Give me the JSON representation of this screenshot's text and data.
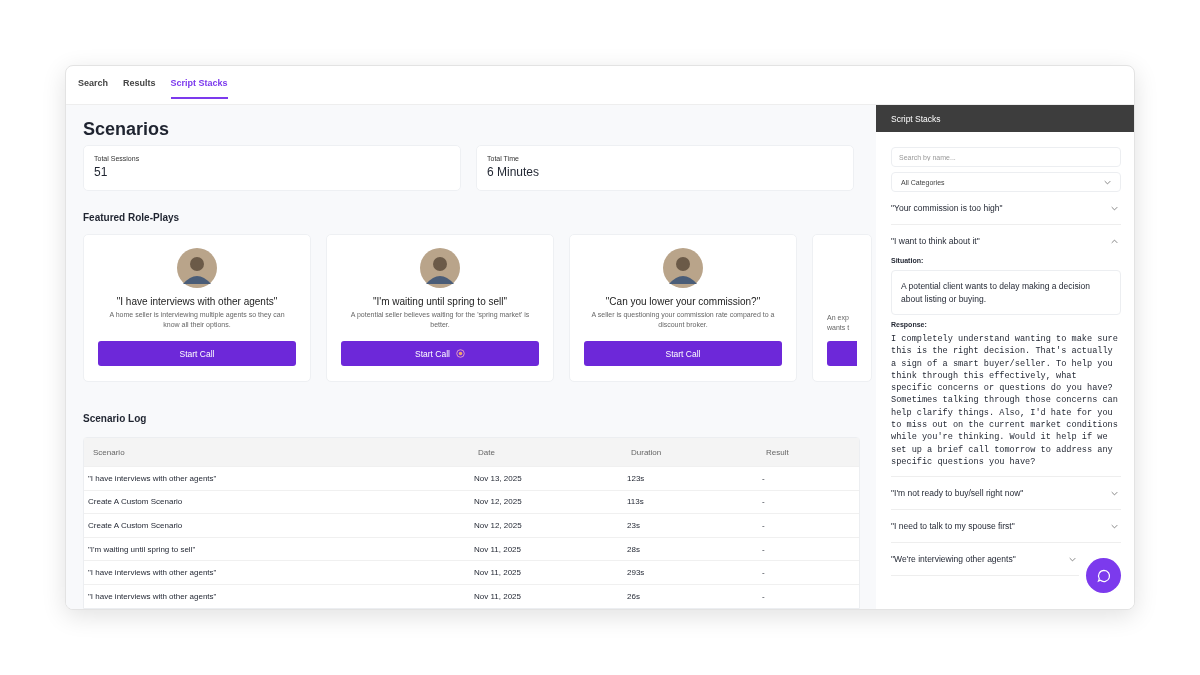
{
  "tabs": [
    {
      "label": "Search",
      "selected": false
    },
    {
      "label": "Results",
      "selected": false
    },
    {
      "label": "Script Stacks",
      "selected": true
    }
  ],
  "main": {
    "title": "Scenarios",
    "stats": [
      {
        "label": "Total Sessions",
        "value": "51"
      },
      {
        "label": "Total Time",
        "value": "6 Minutes"
      }
    ],
    "featured_title": "Featured Role-Plays",
    "featured": [
      {
        "kind": "full",
        "title": "\"I have interviews with other agents\"",
        "description": "A home seller is interviewing multiple agents so they can know all their options.",
        "button": "Start Call",
        "button_icon": false
      },
      {
        "kind": "full",
        "title": "\"I'm waiting until spring to sell\"",
        "description": "A potential seller believes waiting for the 'spring market' is better.",
        "button": "Start Call",
        "button_icon": true
      },
      {
        "kind": "full",
        "title": "\"Can you lower your commission?\"",
        "description": "A seller is questioning your commission rate compared to a discount broker.",
        "button": "Start Call",
        "button_icon": false
      },
      {
        "kind": "partial",
        "description_lines": [
          "An exp",
          "wants t"
        ]
      }
    ],
    "log_title": "Scenario Log",
    "table": {
      "columns": [
        "Scenario",
        "Date",
        "Duration",
        "Result"
      ],
      "rows": [
        [
          "\"I have interviews with other agents\"",
          "Nov 13, 2025",
          "123s",
          "-"
        ],
        [
          "Create A Custom Scenario",
          "Nov 12, 2025",
          "113s",
          "-"
        ],
        [
          "Create A Custom Scenario",
          "Nov 12, 2025",
          "23s",
          "-"
        ],
        [
          "\"I'm waiting until spring to sell\"",
          "Nov 11, 2025",
          "28s",
          "-"
        ],
        [
          "\"I have interviews with other agents\"",
          "Nov 11, 2025",
          "293s",
          "-"
        ],
        [
          "\"I have interviews with other agents\"",
          "Nov 11, 2025",
          "26s",
          "-"
        ]
      ]
    }
  },
  "sidebar": {
    "title": "Script Stacks",
    "search": {
      "placeholder": "Search by name..."
    },
    "category": {
      "value": "All Categories"
    },
    "items": [
      {
        "title": "\"Your commission is too high\"",
        "expanded": false
      },
      {
        "title": "\"I want to think about it\"",
        "expanded": true,
        "situation_label": "Situation:",
        "situation": "A potential client wants to delay making a decision about listing or buying.",
        "response_label": "Response:",
        "response": "I completely understand wanting to make sure this is the right decision. That's actually a sign of a smart buyer/seller. To help you think through this effectively, what specific concerns or questions do you have? Sometimes talking through those concerns can help clarify things. Also, I'd hate for you to miss out on the current market conditions while you're thinking. Would it help if we set up a brief call tomorrow to address any specific questions you have?"
      },
      {
        "title": "\"I'm not ready to buy/sell right now\"",
        "expanded": false
      },
      {
        "title": "\"I need to talk to my spouse first\"",
        "expanded": false
      },
      {
        "title": "\"We're interviewing other agents\"",
        "expanded": false
      }
    ]
  }
}
